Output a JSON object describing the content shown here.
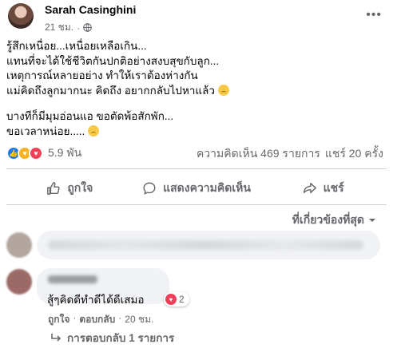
{
  "post": {
    "author": "Sarah Casinghini",
    "time": "21 ชม.",
    "more_icon": "ellipsis-icon",
    "lines": [
      "รู้สึกเหนื่อย...เหนื่อยเหลือเกิน...",
      "แทนที่จะได้ใช้ชีวิตกันปกติอย่างสงบสุขกับลูก...",
      "เหตุการณ์หลายอย่าง ทำให้เราต้องห่างกัน",
      "แม่คิดถึงลูกมากนะ คิดถึง อยากกลับไปหาแล้ว"
    ],
    "lines2": [
      "บางทีก็มีมุมอ่อนแอ ขอตัดพ้อสักพัก...",
      "ขอเวลาหน่อย....."
    ]
  },
  "reactions": {
    "count": "5.9 พัน",
    "comments": "ความคิดเห็น 469 รายการ",
    "shares": "แชร์ 20 ครั้ง"
  },
  "actions": {
    "like": "ถูกใจ",
    "comment": "แสดงความคิดเห็น",
    "share": "แชร์"
  },
  "comments_section": {
    "sort_label": "ที่เกี่ยวข้องที่สุด",
    "comment_text": "สู้ๆคิดดีทำดีได้ดีเสมอ",
    "comment_reactions": "2",
    "comment_like": "ถูกใจ",
    "comment_reply": "ตอบกลับ",
    "comment_time": "20 ชม.",
    "replies_label": "การตอบกลับ 1 รายการ"
  },
  "colors": {
    "like_blue": "#1877f2",
    "love_red": "#f33e58",
    "care_yellow": "#f7b125",
    "secondary_text": "#65676b"
  }
}
